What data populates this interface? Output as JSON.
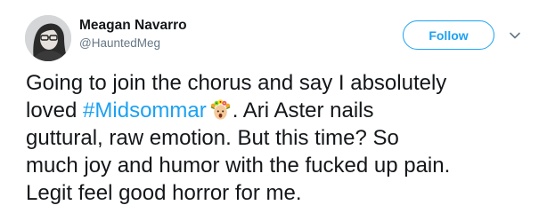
{
  "author": {
    "display_name": "Meagan Navarro",
    "handle": "@HauntedMeg",
    "avatar_icon": "profile-photo"
  },
  "actions": {
    "follow_label": "Follow",
    "more_icon": "chevron-down-icon"
  },
  "tweet": {
    "line1": "Going to join the chorus and say I absolutely",
    "line2_prefix": "loved ",
    "hashtag": "#Midsommar",
    "hashtag_emoji": "flower-crown-emoji",
    "line2_suffix": ". Ari Aster nails",
    "line3": "guttural, raw emotion. But this time? So",
    "line4": "much joy and humor with the fucked up pain.",
    "line5": "Legit feel good horror for me."
  },
  "colors": {
    "accent": "#1da1f2",
    "text": "#14171a",
    "muted": "#657786"
  }
}
